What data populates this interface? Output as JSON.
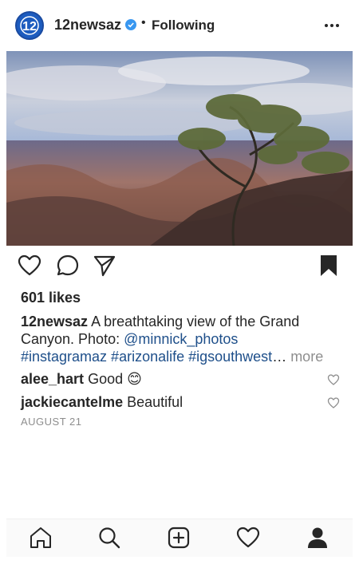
{
  "post": {
    "account": "12newsaz",
    "avatar_text": "12",
    "follow_status": "Following",
    "separator": "•",
    "likes": "601 likes",
    "caption_user": "12newsaz",
    "caption_text_1": " A breathtaking view of the Grand Canyon. Photo: ",
    "caption_mention": "@minnick_photos",
    "caption_hashtags": "#instagramaz #arizonalife #igsouthwest",
    "caption_ellipsis": "…",
    "caption_more": " more",
    "comments": [
      {
        "user": "alee_hart",
        "text": " Good ",
        "emoji": "😊"
      },
      {
        "user": "jackiecantelme",
        "text": " Beautiful",
        "emoji": ""
      }
    ],
    "date": "AUGUST 21"
  },
  "icons": {
    "verified": "verified-badge-icon",
    "options": "more-options-icon",
    "like": "heart-icon",
    "comment": "comment-icon",
    "share": "send-icon",
    "save": "bookmark-icon",
    "tabs": [
      "home-icon",
      "search-icon",
      "new-post-icon",
      "activity-heart-icon",
      "profile-icon"
    ]
  },
  "colors": {
    "verified": "#3897f0",
    "link": "#1e4f8a",
    "muted": "#8e8e8e"
  }
}
